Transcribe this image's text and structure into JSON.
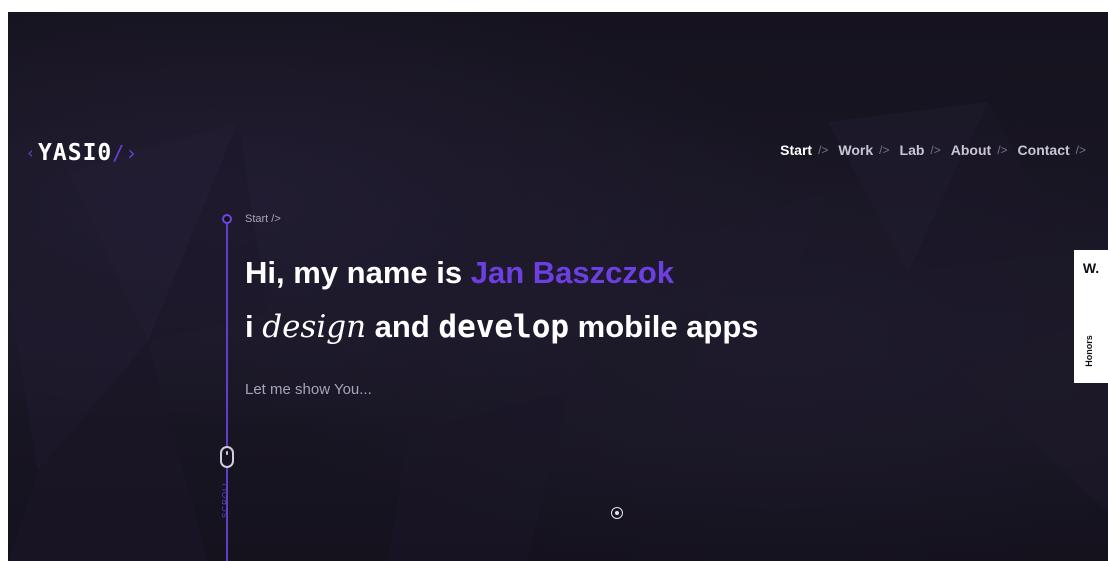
{
  "logo": {
    "open": "‹",
    "text": "YASI0",
    "close": "/›"
  },
  "nav": {
    "items": [
      {
        "label": "Start",
        "sep": "/>"
      },
      {
        "label": "Work",
        "sep": "/>"
      },
      {
        "label": "Lab",
        "sep": "/>"
      },
      {
        "label": "About",
        "sep": "/>"
      },
      {
        "label": "Contact",
        "sep": "/>"
      }
    ]
  },
  "breadcrumb": "Start />",
  "hero": {
    "line1_prefix": "Hi, my name is ",
    "name": "Jan Baszczok",
    "line2_i": "i ",
    "line2_design": "design",
    "line2_and": " and ",
    "line2_develop": "develop",
    "line2_suffix": " mobile apps",
    "lead": "Let me show You..."
  },
  "scroll_label": "SCROLL",
  "award": {
    "mark": "W.",
    "label": "Honors"
  },
  "colors": {
    "accent": "#6c3fe0",
    "background": "#16131f",
    "text": "#ffffff",
    "muted": "#a8a3b8"
  }
}
